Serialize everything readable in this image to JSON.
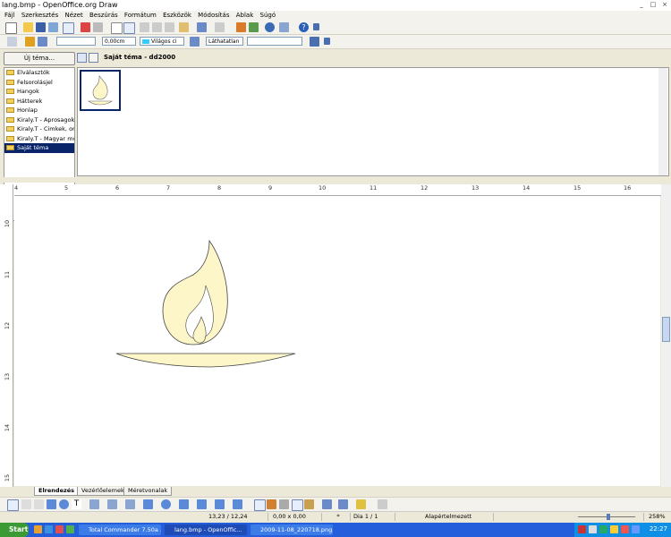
{
  "window": {
    "title": "lang.bmp - OpenOffice.org Draw"
  },
  "menu": [
    "Fájl",
    "Szerkesztés",
    "Nézet",
    "Beszúrás",
    "Formátum",
    "Eszközök",
    "Módosítás",
    "Ablak",
    "Súgó"
  ],
  "line_props": {
    "width_value": "0,00cm",
    "color_name": "Világos ci",
    "visibility": "Láthatatlan"
  },
  "gallery": {
    "new_theme_label": "Új téma...",
    "header_title": "Saját téma - dd2000",
    "themes": [
      {
        "label": "Elválasztók",
        "selected": false
      },
      {
        "label": "Felsorolásjel",
        "selected": false
      },
      {
        "label": "Hangok",
        "selected": false
      },
      {
        "label": "Hátterek",
        "selected": false
      },
      {
        "label": "Honlap",
        "selected": false
      },
      {
        "label": "Kiraly.T - Aprosagok",
        "selected": false
      },
      {
        "label": "Kiraly.T - Cimkek, orna",
        "selected": false
      },
      {
        "label": "Kiraly.T - Magyar moti",
        "selected": false
      },
      {
        "label": "Saját téma",
        "selected": true
      }
    ]
  },
  "ruler": {
    "h_ticks": [
      "4",
      "5",
      "6",
      "7",
      "8",
      "9",
      "10",
      "11",
      "12",
      "13",
      "14",
      "15",
      "16"
    ],
    "v_ticks": [
      "10",
      "11",
      "12",
      "13",
      "14",
      "15"
    ]
  },
  "tabs": [
    "Elrendezés",
    "Vezérlőelemek",
    "Méretvonalak"
  ],
  "status": {
    "position": "13,23 / 12,24",
    "size": "0,00 x 0,00",
    "page": "Dia 1 / 1",
    "style": "Alapértelmezett",
    "zoom": "258%"
  },
  "taskbar": {
    "start_label": "Start",
    "tasks": [
      "Total Commander 7.50a ...",
      "lang.bmp - OpenOffic...",
      "2009-11-08_220718.png..."
    ],
    "clock": "22:27"
  },
  "colors": {
    "flame_fill": "#fdf6c8",
    "selection": "#0a246a",
    "taskbar": "#245edb"
  }
}
